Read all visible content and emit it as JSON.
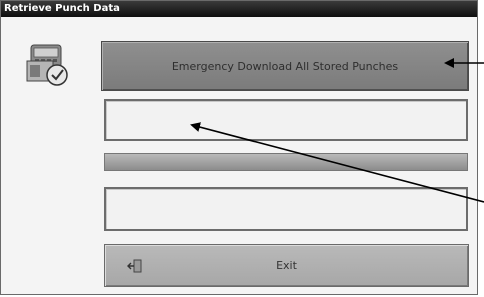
{
  "window": {
    "title": "Retrieve Punch Data"
  },
  "buttons": {
    "emergency_label": "Emergency Download All Stored Punches",
    "exit_label": "Exit"
  },
  "progress": {
    "value_percent": 100
  },
  "icons": {
    "app": "time-clock-download-icon",
    "exit": "exit-door-icon",
    "annotations": "callout-arrow-icon"
  },
  "colors": {
    "titlebar": "#1a1a1a",
    "emergency_button": "#858585",
    "exit_button": "#afafaf",
    "window_bg": "#f4f4f4",
    "arrow": "#000000"
  }
}
